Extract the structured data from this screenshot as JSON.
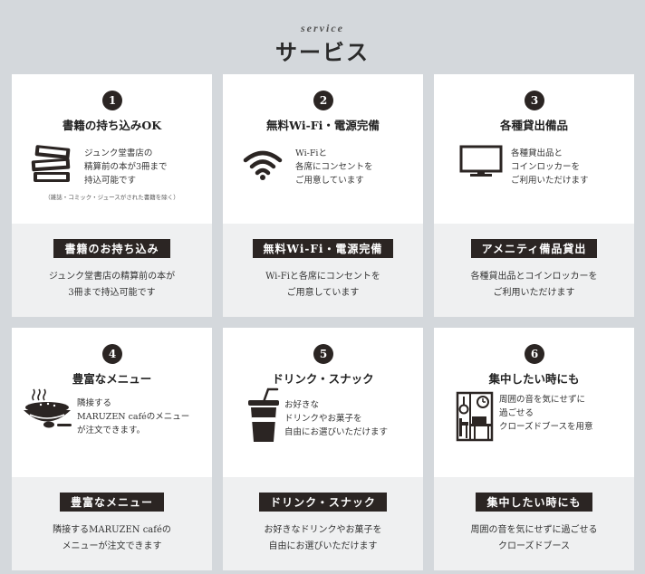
{
  "header": {
    "eyebrow": "service",
    "title": "サービス"
  },
  "cards": [
    {
      "number": "1",
      "heading": "書籍の持ち込みOK",
      "icon": "books-icon",
      "desc": [
        "ジュンク堂書店の",
        "精算前の本が3冊まで",
        "持込可能です"
      ],
      "note": "（雑誌・コミック・ジュースがされた書籍を除く）",
      "badge": "書籍のお持ち込み",
      "caption": [
        "ジュンク堂書店の精算前の本が",
        "3冊まで持込可能です"
      ]
    },
    {
      "number": "2",
      "heading": "無料Wi-Fi・電源完備",
      "icon": "wifi-icon",
      "desc": [
        "Wi-Fiと",
        "各席にコンセントを",
        "ご用意しています"
      ],
      "badge": "無料Wi-Fi・電源完備",
      "caption": [
        "Wi-Fiと各席にコンセントを",
        "ご用意しています"
      ]
    },
    {
      "number": "3",
      "heading": "各種貸出備品",
      "icon": "monitor-icon",
      "desc": [
        "各種貸出品と",
        "コインロッカーを",
        "ご利用いただけます"
      ],
      "badge": "アメニティ備品貸出",
      "caption": [
        "各種貸出品とコインロッカーを",
        "ご利用いただけます"
      ]
    },
    {
      "number": "4",
      "heading": "豊富なメニュー",
      "icon": "rice-bowl-icon",
      "desc": [
        "隣接する",
        "MARUZEN caféのメニュー",
        "が注文できます。"
      ],
      "badge": "豊富なメニュー",
      "caption": [
        "隣接するMARUZEN caféの",
        "メニューが注文できます"
      ]
    },
    {
      "number": "5",
      "heading": "ドリンク・スナック",
      "icon": "drink-cup-icon",
      "desc": [
        "お好きな",
        "ドリンクやお菓子を",
        "自由にお選びいただけます"
      ],
      "badge": "ドリンク・スナック",
      "caption": [
        "お好きなドリンクやお菓子を",
        "自由にお選びいただけます"
      ]
    },
    {
      "number": "6",
      "heading": "集中したい時にも",
      "icon": "booth-icon",
      "desc": [
        "周囲の音を気にせずに",
        "過ごせる",
        "クローズドブースを用意"
      ],
      "badge": "集中したい時にも",
      "caption": [
        "周囲の音を気にせずに過ごせる",
        "クローズドブース"
      ]
    }
  ]
}
